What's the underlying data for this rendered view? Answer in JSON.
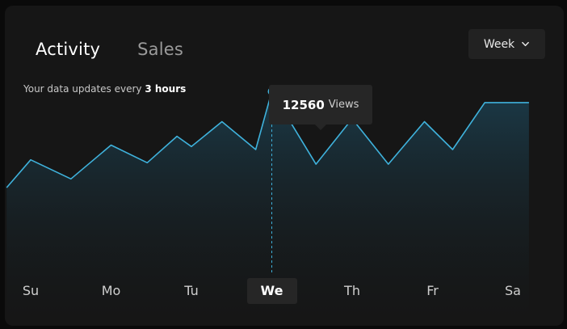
{
  "tabs": [
    {
      "label": "Activity",
      "active": true
    },
    {
      "label": "Sales",
      "active": false
    }
  ],
  "period": {
    "label": "Week"
  },
  "subtitle": {
    "prefix": "Your data updates every ",
    "emphasis": "3 hours"
  },
  "tooltip": {
    "value": "12560",
    "unit": "Views"
  },
  "colors": {
    "line": "#3fb2dc",
    "fill_top": "#1b3c4b",
    "card": "#161616"
  },
  "chart_data": {
    "type": "area",
    "categories": [
      "Su",
      "Mo",
      "Tu",
      "We",
      "Th",
      "Fr",
      "Sa"
    ],
    "selected": "We",
    "ylim": [
      0,
      14000
    ],
    "x": [
      -0.3,
      0.0,
      0.5,
      1.0,
      1.45,
      1.82,
      2.0,
      2.38,
      2.8,
      3.0,
      3.55,
      4.0,
      4.45,
      4.9,
      5.25,
      5.65,
      6.0,
      6.2
    ],
    "y": [
      6000,
      7900,
      6600,
      8900,
      7700,
      9500,
      8800,
      10500,
      8600,
      12560,
      7600,
      10700,
      7600,
      10500,
      8600,
      11800,
      11800,
      11800
    ],
    "tooltip_index": 9
  }
}
